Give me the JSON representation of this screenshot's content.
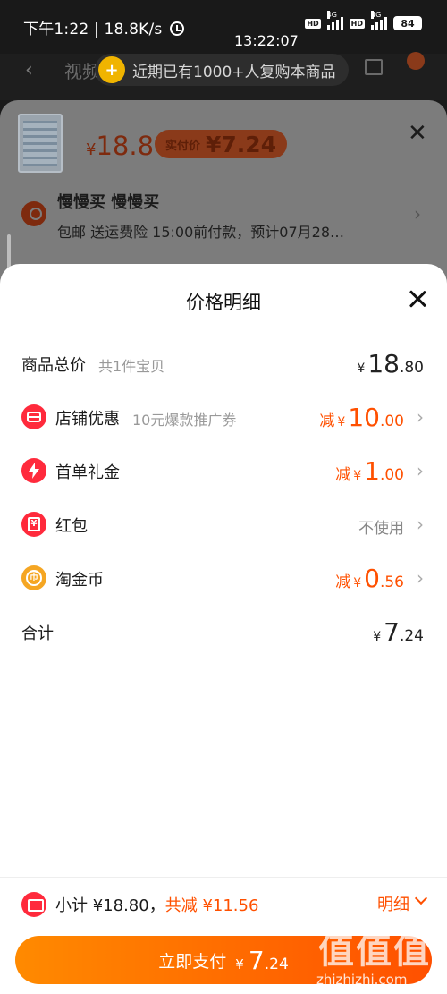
{
  "status_bar": {
    "left_text": "下午1:22 | 18.8K/s",
    "time": "13:22:07",
    "network_1": "4G",
    "network_2": "4G",
    "hd_badge": "HD",
    "battery": "84"
  },
  "background_page": {
    "title": "视频",
    "toast_icon_symbol": "+",
    "toast_text": "近期已有1000+人复购本商品"
  },
  "underlying_sheet": {
    "price_yen": "¥",
    "price": "18.8",
    "actual_price_label": "实付价",
    "actual_price": "¥7.24",
    "recipient": "慢慢买 慢慢买",
    "shipping_info": "包邮  送运费险  15:00前付款，预计07月28…"
  },
  "price_detail": {
    "title": "价格明细",
    "rows": [
      {
        "label": "商品总价",
        "sub": "共1件宝贝",
        "prefix": "",
        "yen": "¥",
        "int": "18",
        "dec": ".80"
      },
      {
        "label": "店铺优惠",
        "sub": "10元爆款推广券",
        "prefix": "减",
        "yen": "¥",
        "int": "10",
        "dec": ".00"
      },
      {
        "label": "首单礼金",
        "sub": "",
        "prefix": "减",
        "yen": "¥",
        "int": "1",
        "dec": ".00"
      },
      {
        "label": "红包",
        "sub": "",
        "value_text": "不使用"
      },
      {
        "label": "淘金币",
        "sub": "",
        "prefix": "减",
        "yen": "¥",
        "int": "0",
        "dec": ".56"
      },
      {
        "label": "合计",
        "yen": "¥",
        "int": "7",
        "dec": ".24"
      }
    ],
    "icon_names": [
      "shop-coupon-icon",
      "lightning-icon",
      "red-envelope-icon",
      "gold-coin-icon"
    ],
    "icon_glyphs": {
      "red_envelope": "¥",
      "gold_coin": "币"
    }
  },
  "footer": {
    "subtotal_text": "小计 ¥18.80，",
    "reduction_text": "共减 ¥11.56",
    "detail_label": "明细",
    "pay_label": "立即支付",
    "pay_yen": "¥",
    "pay_int": "7",
    "pay_dec": ".24"
  },
  "watermark": {
    "logo": "值值值",
    "site": "zhizhizhi.com"
  },
  "colors": {
    "accent": "#ff5000",
    "pay_gradient_start": "#ff8a00",
    "icon_red": "#ff2a3c",
    "icon_gold": "#f5a623"
  }
}
